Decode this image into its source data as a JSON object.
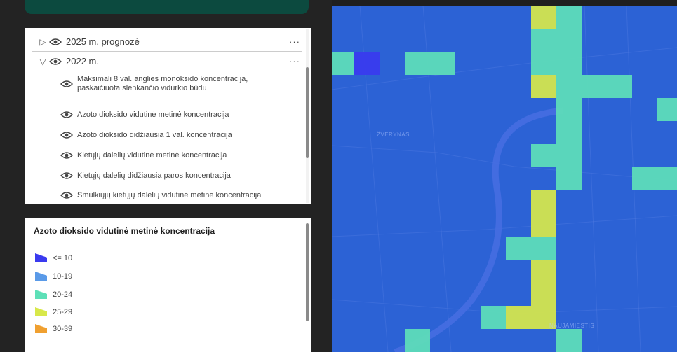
{
  "layers": {
    "groups": [
      {
        "label": "2025 m. prognozė",
        "expanded": false,
        "more": "···"
      },
      {
        "label": "2022 m.",
        "expanded": true,
        "more": "···"
      }
    ],
    "sublayers": [
      {
        "label": "Maksimali 8 val. anglies monoksido koncentracija, paskaičiuota slenkančio vidurkio būdu",
        "more": "···"
      },
      {
        "label": "Azoto dioksido vidutinė metinė koncentracija",
        "more": "···"
      },
      {
        "label": "Azoto dioksido didžiausia 1 val. koncentracija",
        "more": "···"
      },
      {
        "label": "Kietųjų dalelių vidutinė metinė koncentracija",
        "more": "···"
      },
      {
        "label": "Kietųjų dalelių didžiausia paros koncentracija",
        "more": "···"
      },
      {
        "label": "Smulkiųjų kietųjų dalelių vidutinė metinė koncentracija",
        "more": "···"
      }
    ]
  },
  "legend": {
    "title": "Azoto dioksido vidutinė metinė koncentracija",
    "items": [
      {
        "label": "<= 10",
        "color": "#3a3aef"
      },
      {
        "label": "10-19",
        "color": "#5a9ae8"
      },
      {
        "label": "20-24",
        "color": "#5ee0b8"
      },
      {
        "label": "25-29",
        "color": "#d8e84a"
      },
      {
        "label": "30-39",
        "color": "#f0a030"
      }
    ]
  },
  "map": {
    "district_labels": [
      "ŽVĖRYNAS",
      "NAUJAMIESTIS"
    ],
    "cells": [
      {
        "col": 8,
        "row": 0,
        "cls": 3
      },
      {
        "col": 9,
        "row": 0,
        "cls": 2
      },
      {
        "col": 0,
        "row": 2,
        "cls": 2
      },
      {
        "col": 1,
        "row": 2,
        "cls": 0
      },
      {
        "col": 3,
        "row": 2,
        "cls": 2
      },
      {
        "col": 4,
        "row": 2,
        "cls": 2
      },
      {
        "col": 8,
        "row": 1,
        "cls": 2
      },
      {
        "col": 9,
        "row": 1,
        "cls": 2
      },
      {
        "col": 8,
        "row": 2,
        "cls": 2
      },
      {
        "col": 9,
        "row": 2,
        "cls": 2
      },
      {
        "col": 8,
        "row": 3,
        "cls": 3
      },
      {
        "col": 9,
        "row": 3,
        "cls": 2
      },
      {
        "col": 10,
        "row": 3,
        "cls": 2
      },
      {
        "col": 11,
        "row": 3,
        "cls": 2
      },
      {
        "col": 9,
        "row": 4,
        "cls": 2
      },
      {
        "col": 13,
        "row": 4,
        "cls": 2
      },
      {
        "col": 9,
        "row": 5,
        "cls": 2
      },
      {
        "col": 8,
        "row": 6,
        "cls": 2
      },
      {
        "col": 9,
        "row": 6,
        "cls": 2
      },
      {
        "col": 9,
        "row": 7,
        "cls": 2
      },
      {
        "col": 12,
        "row": 7,
        "cls": 2
      },
      {
        "col": 13,
        "row": 7,
        "cls": 2
      },
      {
        "col": 8,
        "row": 8,
        "cls": 3
      },
      {
        "col": 8,
        "row": 9,
        "cls": 3
      },
      {
        "col": 7,
        "row": 10,
        "cls": 2
      },
      {
        "col": 8,
        "row": 10,
        "cls": 2
      },
      {
        "col": 8,
        "row": 11,
        "cls": 3
      },
      {
        "col": 8,
        "row": 12,
        "cls": 3
      },
      {
        "col": 6,
        "row": 13,
        "cls": 2
      },
      {
        "col": 7,
        "row": 13,
        "cls": 3
      },
      {
        "col": 8,
        "row": 13,
        "cls": 3
      },
      {
        "col": 3,
        "row": 14,
        "cls": 2
      },
      {
        "col": 9,
        "row": 14,
        "cls": 2
      }
    ]
  }
}
